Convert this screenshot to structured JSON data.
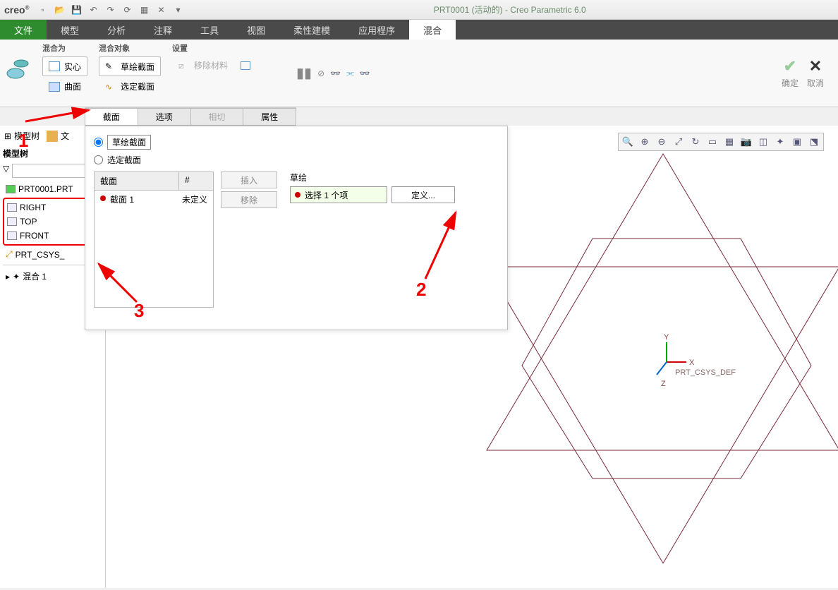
{
  "app": {
    "logo": "creo",
    "title": "PRT0001 (活动的) - Creo Parametric 6.0"
  },
  "ribbonTabs": {
    "file": "文件",
    "model": "模型",
    "analysis": "分析",
    "annotate": "注释",
    "tools": "工具",
    "view": "视图",
    "flex": "柔性建模",
    "apps": "应用程序",
    "blend": "混合"
  },
  "ribbon": {
    "group1": {
      "label": "混合为",
      "solid": "实心",
      "surface": "曲面"
    },
    "group2": {
      "label": "混合对象",
      "sketchSec": "草绘截面",
      "selectSec": "选定截面"
    },
    "group3": {
      "label": "设置",
      "removeMat": "移除材料"
    },
    "confirm": "确定",
    "cancel": "取消"
  },
  "subTabs": {
    "section": "截面",
    "options": "选项",
    "tangent": "相切",
    "props": "属性"
  },
  "tree": {
    "panelLabel": "模型树",
    "treeLabel": "模型树",
    "part": "PRT0001.PRT",
    "right": "RIGHT",
    "top": "TOP",
    "front": "FRONT",
    "csys": "PRT_CSYS_",
    "blend": "混合 1"
  },
  "sectionPanel": {
    "radioSketch": "草绘截面",
    "radioSelect": "选定截面",
    "colSection": "截面",
    "colNum": "#",
    "row1": "截面 1",
    "row1val": "未定义",
    "insert": "插入",
    "remove": "移除",
    "sketchLbl": "草绘",
    "selectItem": "选择 1 个项",
    "define": "定义..."
  },
  "viewport": {
    "csysText": "PRT_CSYS_DEF",
    "x": "X",
    "y": "Y",
    "z": "Z"
  },
  "anno": {
    "n1": "1",
    "n2": "2",
    "n3": "3"
  }
}
